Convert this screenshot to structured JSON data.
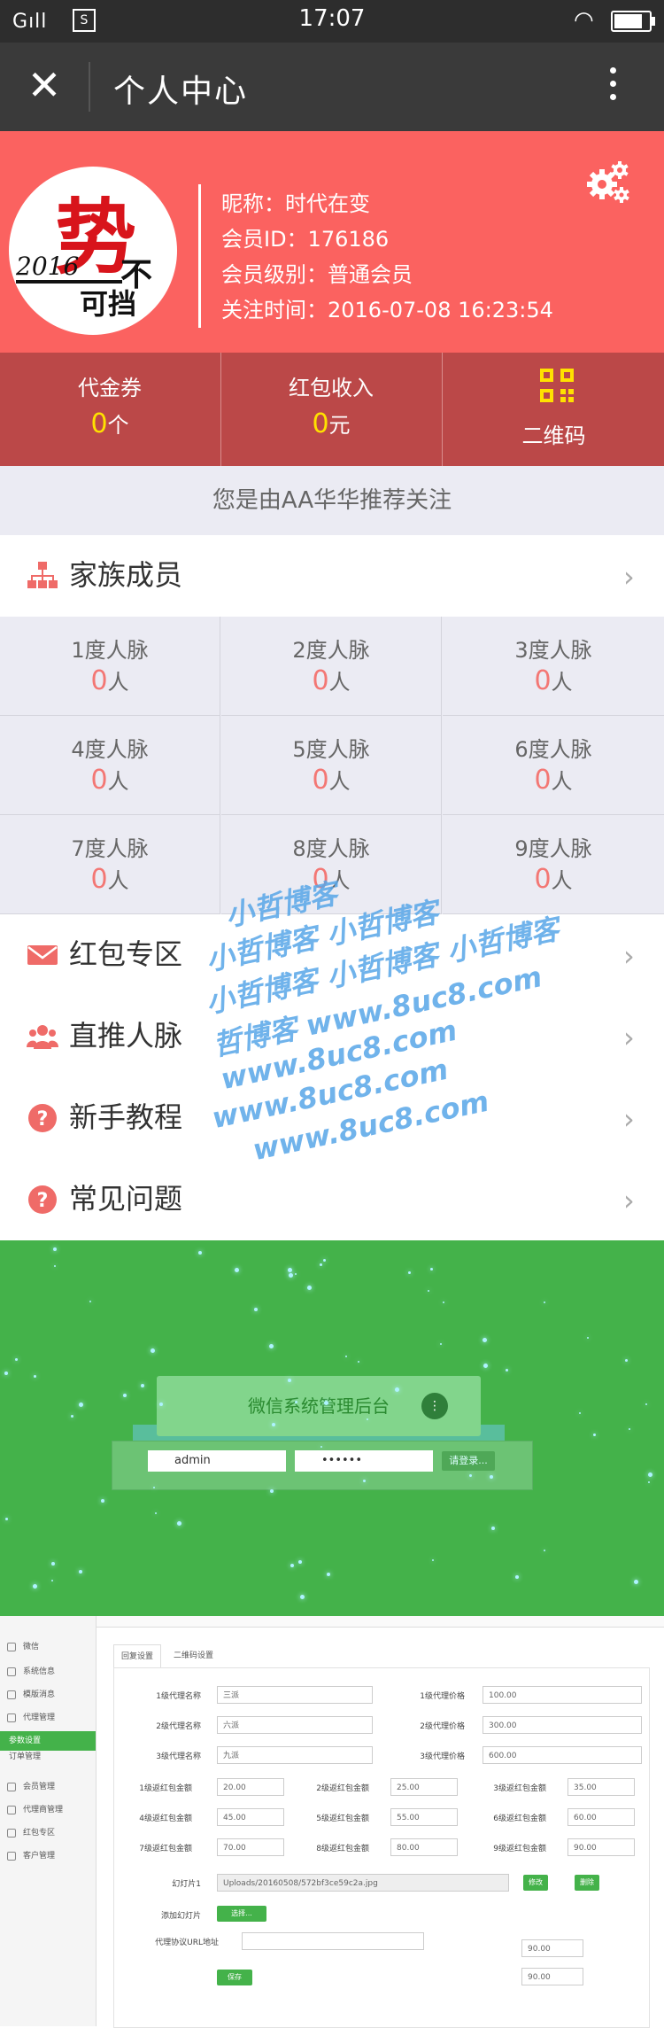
{
  "status_bar": {
    "time": "17:07",
    "signal": "G",
    "battery_level": 0.85
  },
  "header": {
    "title": "个人中心"
  },
  "profile": {
    "nickname_line": "昵称：时代在变",
    "member_id_line": "会员ID：176186",
    "level_line": "会员级别：普通会员",
    "follow_time_line": "关注时间：2016-07-08 16:23:54",
    "avatar_text": {
      "year": "2016",
      "main": "势",
      "sub1": "不",
      "sub2": "可挡"
    }
  },
  "stats": [
    {
      "label": "代金券",
      "value": "0",
      "unit": "个"
    },
    {
      "label": "红包收入",
      "value": "0",
      "unit": "元"
    },
    {
      "label": "二维码"
    }
  ],
  "referral_text": "您是由AA华华推荐关注",
  "family": {
    "label": "家族成员"
  },
  "network": [
    {
      "label": "1度人脉",
      "value": "0",
      "unit": "人"
    },
    {
      "label": "2度人脉",
      "value": "0",
      "unit": "人"
    },
    {
      "label": "3度人脉",
      "value": "0",
      "unit": "人"
    },
    {
      "label": "4度人脉",
      "value": "0",
      "unit": "人"
    },
    {
      "label": "5度人脉",
      "value": "0",
      "unit": "人"
    },
    {
      "label": "6度人脉",
      "value": "0",
      "unit": "人"
    },
    {
      "label": "7度人脉",
      "value": "0",
      "unit": "人"
    },
    {
      "label": "8度人脉",
      "value": "0",
      "unit": "人"
    },
    {
      "label": "9度人脉",
      "value": "0",
      "unit": "人"
    }
  ],
  "menu": [
    {
      "label": "红包专区",
      "icon": "envelope-icon"
    },
    {
      "label": "直推人脉",
      "icon": "users-icon"
    },
    {
      "label": "新手教程",
      "icon": "question-icon"
    },
    {
      "label": "常见问题",
      "icon": "question-icon"
    }
  ],
  "watermarks": [
    "小哲博客",
    "小哲博客 小哲博客",
    "小哲博客 小哲博客 小哲博客",
    "哲博客 www.8uc8.com",
    "www.8uc8.com",
    "www.8uc8.com",
    "www.8uc8.com"
  ],
  "login": {
    "title": "微信系统管理后台",
    "username": "admin",
    "password": "••••••",
    "button": "请登录..."
  },
  "admin": {
    "sidebar": [
      "微信",
      "系统信息",
      "模版消息",
      "代理管理",
      "参数设置",
      "订单管理",
      "会员管理",
      "代理商管理",
      "红包专区",
      "客户管理"
    ],
    "active_index": 4,
    "tabs": [
      "回复设置",
      "二维码设置"
    ],
    "fields": {
      "agent1_name_label": "1级代理名称",
      "agent1_name": "三派",
      "agent2_name_label": "2级代理名称",
      "agent2_name": "六派",
      "agent3_name_label": "3级代理名称",
      "agent3_name": "九派",
      "agent1_price_label": "1级代理价格",
      "agent1_price": "100.00",
      "agent2_price_label": "2级代理价格",
      "agent2_price": "300.00",
      "agent3_price_label": "3级代理价格",
      "agent3_price": "600.00",
      "rp1_label": "1级返红包金额",
      "rp1": "20.00",
      "rp2_label": "2级返红包金额",
      "rp2": "25.00",
      "rp3_label": "3级返红包金额",
      "rp3": "35.00",
      "rp4_label": "4级返红包金额",
      "rp4": "45.00",
      "rp5_label": "5级返红包金额",
      "rp5": "55.00",
      "rp6_label": "6级返红包金额",
      "rp6": "60.00",
      "rp7_label": "7级返红包金额",
      "rp7": "70.00",
      "rp8_label": "8级返红包金额",
      "rp8": "80.00",
      "rp9_label": "9级返红包金额",
      "rp9": "90.00",
      "slide_label": "幻灯片1",
      "slide_path": "Uploads/20160508/572bf3ce59c2a.jpg",
      "slide_btn1": "修改",
      "slide_btn2": "删除",
      "add_slide_label": "添加幻灯片",
      "choose_btn": "选择...",
      "agreement_label": "代理协议URL地址",
      "extra_value1": "90.00",
      "extra_value2": "90.00",
      "save_btn": "保存"
    }
  }
}
